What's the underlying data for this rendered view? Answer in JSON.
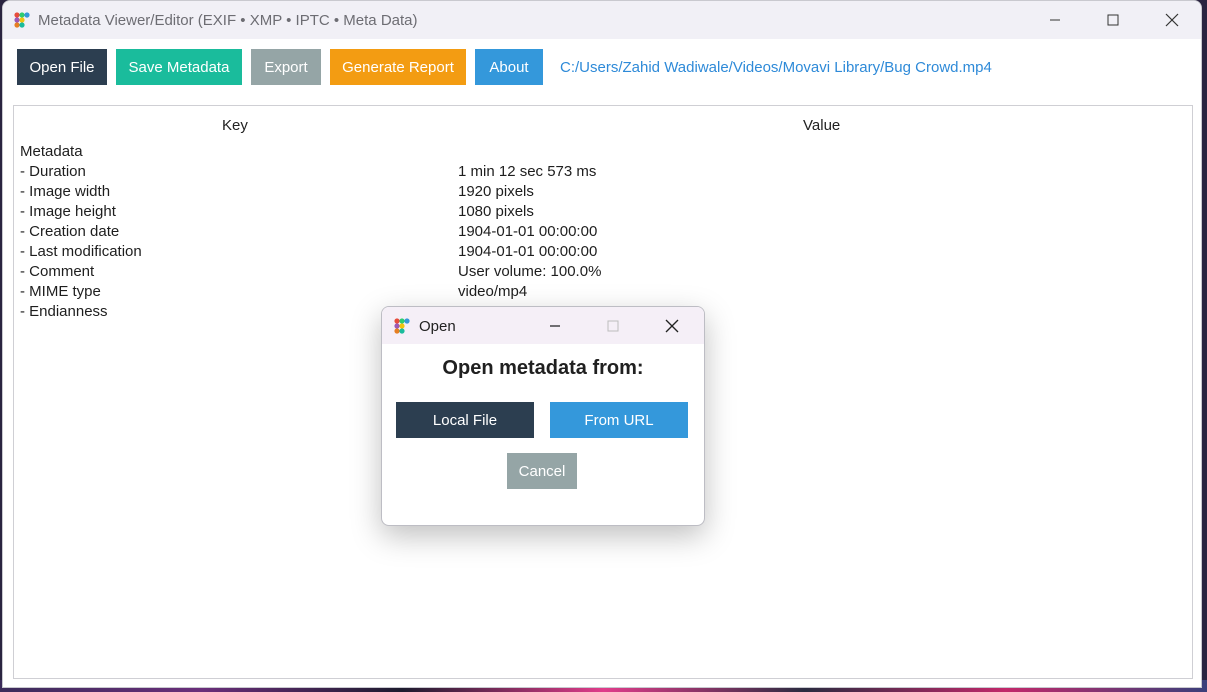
{
  "window": {
    "title": "Metadata Viewer/Editor (EXIF • XMP • IPTC • Meta Data)"
  },
  "toolbar": {
    "open_file": "Open File",
    "save_metadata": "Save Metadata",
    "export": "Export",
    "generate_report": "Generate Report",
    "about": "About",
    "file_path": "C:/Users/Zahid Wadiwale/Videos/Movavi Library/Bug Crowd.mp4"
  },
  "colors": {
    "open_file": "#2c3e50",
    "save_metadata": "#1abc9c",
    "export": "#95a5a6",
    "generate_report": "#f39c12",
    "about": "#3498db"
  },
  "table": {
    "headers": {
      "key": "Key",
      "value": "Value"
    },
    "rows": [
      {
        "key": "Metadata",
        "value": ""
      },
      {
        "key": "- Duration",
        "value": "1 min 12 sec 573 ms"
      },
      {
        "key": "- Image width",
        "value": "1920 pixels"
      },
      {
        "key": "- Image height",
        "value": "1080 pixels"
      },
      {
        "key": "- Creation date",
        "value": "1904-01-01 00:00:00"
      },
      {
        "key": "- Last modification",
        "value": "1904-01-01 00:00:00"
      },
      {
        "key": "- Comment",
        "value": "User volume: 100.0%"
      },
      {
        "key": "- MIME type",
        "value": "video/mp4"
      },
      {
        "key": "- Endianness",
        "value": ""
      }
    ]
  },
  "dialog": {
    "title": "Open",
    "heading": "Open metadata from:",
    "local_file": "Local File",
    "from_url": "From URL",
    "cancel": "Cancel"
  }
}
